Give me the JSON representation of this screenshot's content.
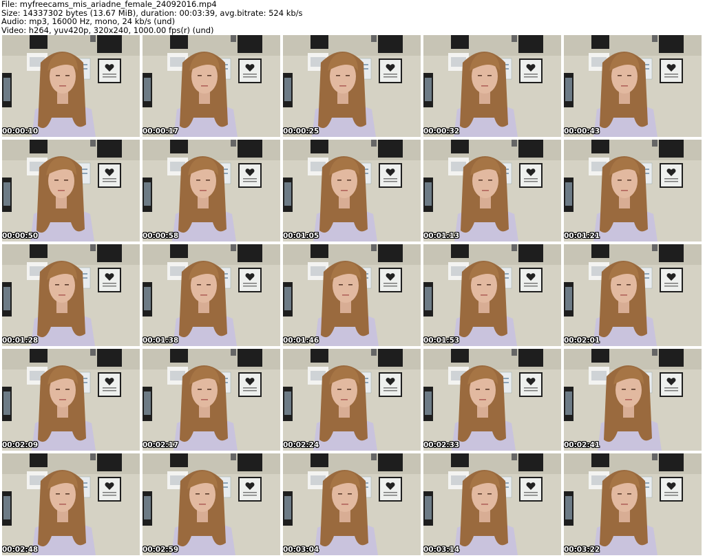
{
  "header": {
    "file": "File: myfreecams_mis_ariadne_female_24092016.mp4",
    "size": "Size: 14337302 bytes (13.67 MiB), duration: 00:03:39, avg.bitrate: 524 kb/s",
    "audio": "Audio: mp3, 16000 Hz, mono, 24 kb/s (und)",
    "video": "Video: h264, yuv420p, 320x240, 1000.00 fps(r) (und)"
  },
  "thumbnails": [
    {
      "time": "00:00:10"
    },
    {
      "time": "00:00:17"
    },
    {
      "time": "00:00:25"
    },
    {
      "time": "00:00:32"
    },
    {
      "time": "00:00:43"
    },
    {
      "time": "00:00:50"
    },
    {
      "time": "00:00:58"
    },
    {
      "time": "00:01:05"
    },
    {
      "time": "00:01:13"
    },
    {
      "time": "00:01:21"
    },
    {
      "time": "00:01:28"
    },
    {
      "time": "00:01:38"
    },
    {
      "time": "00:01:46"
    },
    {
      "time": "00:01:53"
    },
    {
      "time": "00:02:01"
    },
    {
      "time": "00:02:09"
    },
    {
      "time": "00:02:17"
    },
    {
      "time": "00:02:24"
    },
    {
      "time": "00:02:33"
    },
    {
      "time": "00:02:41"
    },
    {
      "time": "00:02:48"
    },
    {
      "time": "00:02:59"
    },
    {
      "time": "00:03:04"
    },
    {
      "time": "00:03:14"
    },
    {
      "time": "00:03:22"
    }
  ],
  "colors": {
    "wall": "#d5d2c4",
    "hair": "#9a6a3e",
    "skin": "#e2b9a0",
    "shirt": "#c9c3dd",
    "frame": "#1e1e1e",
    "poster": "#e8ecef",
    "timestamp": "#ffffff"
  }
}
